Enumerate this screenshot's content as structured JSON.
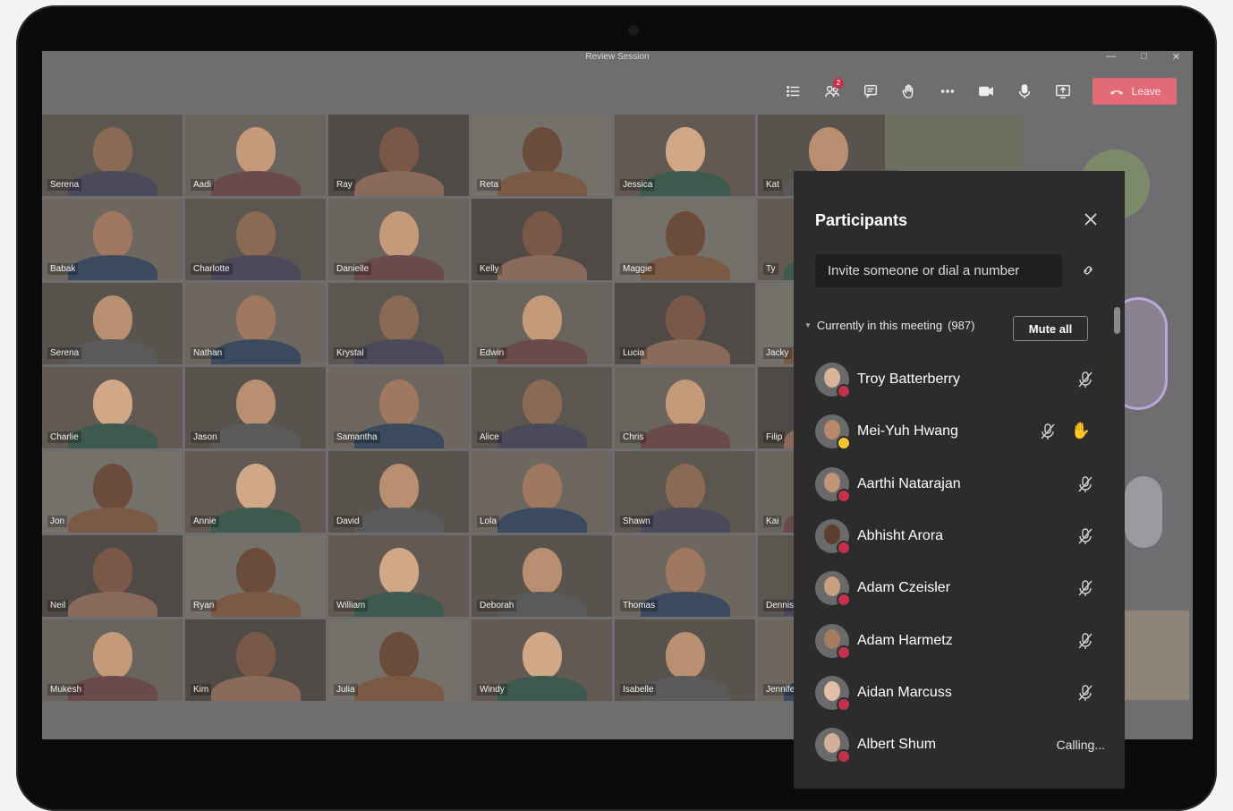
{
  "window": {
    "title": "Review Session"
  },
  "toolbar": {
    "items": [
      {
        "icon": "list-icon"
      },
      {
        "icon": "participants-icon",
        "badge": "2"
      },
      {
        "icon": "chat-icon"
      },
      {
        "icon": "raise-hand-icon"
      },
      {
        "icon": "more-icon"
      },
      {
        "icon": "camera-icon"
      },
      {
        "icon": "mic-icon"
      },
      {
        "icon": "share-icon"
      }
    ],
    "leave_label": "Leave",
    "leave_color": "#e36b78"
  },
  "grid": {
    "names": [
      "Serena",
      "Aadi",
      "Ray",
      "Reta",
      "Jessica",
      "Kat",
      "Babak",
      "Charlotte",
      "Danielle",
      "Kelly",
      "Maggie",
      "Ty",
      "Serena",
      "Nathan",
      "Krystal",
      "Edwin",
      "Lucia",
      "Jacky",
      "Charlie",
      "Jason",
      "Samantha",
      "Alice",
      "Chris",
      "Filip",
      "Jon",
      "Annie",
      "David",
      "Lola",
      "Shawn",
      "Kai",
      "Neil",
      "Ryan",
      "William",
      "Deborah",
      "Thomas",
      "Dennis",
      "Mukesh",
      "Kim",
      "Julia",
      "Windy",
      "Isabelle",
      "Jennifer"
    ]
  },
  "panel": {
    "title": "Participants",
    "invite_placeholder": "Invite someone or dial a number",
    "section_label": "Currently in this meeting",
    "count": "(987)",
    "mute_all_label": "Mute all",
    "participants": [
      {
        "name": "Troy Batterberry",
        "status": "busy",
        "icon": "mic-off-icon"
      },
      {
        "name": "Mei-Yuh Hwang",
        "status": "away",
        "icon": "mic-off-icon",
        "hand": true
      },
      {
        "name": "Aarthi Natarajan",
        "status": "busy",
        "icon": "mic-off-icon"
      },
      {
        "name": "Abhisht Arora",
        "status": "busy",
        "icon": "mic-off-icon"
      },
      {
        "name": "Adam Czeisler",
        "status": "busy",
        "icon": "mic-off-icon"
      },
      {
        "name": "Adam Harmetz",
        "status": "busy",
        "icon": "mic-off-icon"
      },
      {
        "name": "Aidan Marcuss",
        "status": "busy",
        "icon": "mic-off-icon"
      },
      {
        "name": "Albert Shum",
        "status": "busy",
        "calling": "Calling..."
      }
    ]
  },
  "colors": {
    "panel_bg": "#2d2c2c",
    "busy": "#c4314b",
    "away": "#f8c230"
  }
}
